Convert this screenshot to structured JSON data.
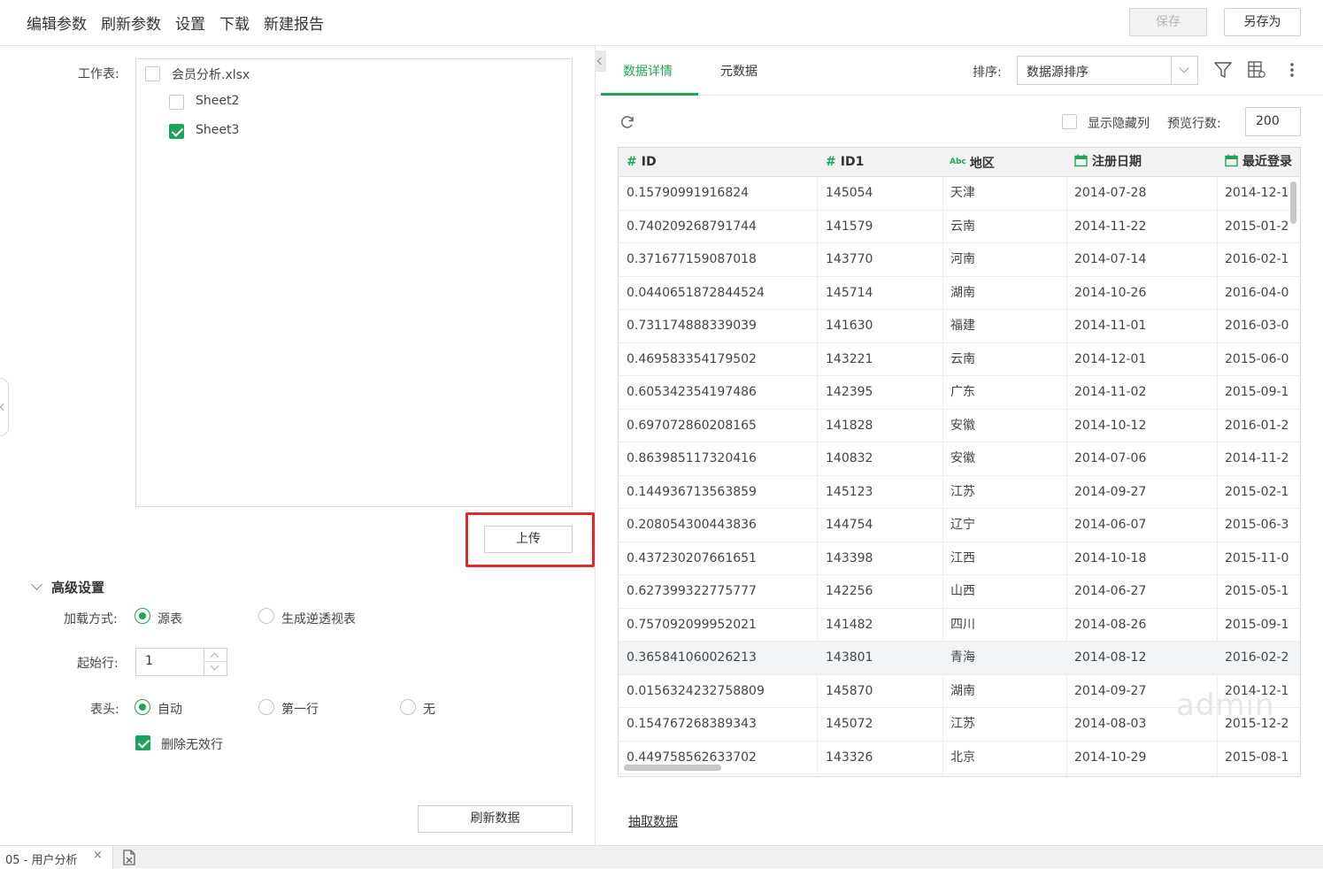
{
  "menu": {
    "items": [
      "编辑参数",
      "刷新参数",
      "设置",
      "下载",
      "新建报告"
    ],
    "save": "保存",
    "save_as": "另存为"
  },
  "left": {
    "worksheet_label": "工作表:",
    "file": {
      "name": "会员分析.xlsx",
      "checked": false
    },
    "sheets": [
      {
        "name": "Sheet2",
        "checked": false
      },
      {
        "name": "Sheet3",
        "checked": true
      }
    ],
    "upload_button": "上传",
    "advanced_title": "高级设置",
    "load_mode_label": "加载方式:",
    "load_mode_options": [
      "源表",
      "生成逆透视表"
    ],
    "start_row_label": "起始行:",
    "start_row_value": "1",
    "header_label": "表头:",
    "header_options": [
      "自动",
      "第一行",
      "无"
    ],
    "delete_invalid_label": "删除无效行",
    "delete_invalid_checked": true,
    "refresh_button": "刷新数据"
  },
  "right": {
    "tabs": [
      "数据详情",
      "元数据"
    ],
    "sort_label": "排序:",
    "sort_value": "数据源排序",
    "show_hidden_label": "显示隐藏列",
    "preview_rows_label": "预览行数:",
    "preview_rows_value": "200",
    "columns": [
      {
        "name": "ID",
        "type_icon": "#"
      },
      {
        "name": "ID1",
        "type_icon": "#"
      },
      {
        "name": "地区",
        "type_icon": "Abc"
      },
      {
        "name": "注册日期",
        "type_icon": "calendar"
      },
      {
        "name": "最近登录",
        "type_icon": "calendar"
      }
    ],
    "rows": [
      [
        "0.15790991916824",
        "145054",
        "天津",
        "2014-07-28",
        "2014-12-1"
      ],
      [
        "0.740209268791744",
        "141579",
        "云南",
        "2014-11-22",
        "2015-01-2"
      ],
      [
        "0.371677159087018",
        "143770",
        "河南",
        "2014-07-14",
        "2016-02-1"
      ],
      [
        "0.0440651872844524",
        "145714",
        "湖南",
        "2014-10-26",
        "2016-04-0"
      ],
      [
        "0.731174888339039",
        "141630",
        "福建",
        "2014-11-01",
        "2016-03-0"
      ],
      [
        "0.469583354179502",
        "143221",
        "云南",
        "2014-12-01",
        "2015-06-0"
      ],
      [
        "0.605342354197486",
        "142395",
        "广东",
        "2014-11-02",
        "2015-09-1"
      ],
      [
        "0.697072860208165",
        "141828",
        "安徽",
        "2014-10-12",
        "2016-01-2"
      ],
      [
        "0.863985117320416",
        "140832",
        "安徽",
        "2014-07-06",
        "2014-11-2"
      ],
      [
        "0.144936713563859",
        "145123",
        "江苏",
        "2014-09-27",
        "2015-02-1"
      ],
      [
        "0.208054300443836",
        "144754",
        "辽宁",
        "2014-06-07",
        "2015-06-3"
      ],
      [
        "0.437230207661651",
        "143398",
        "江西",
        "2014-10-18",
        "2015-11-0"
      ],
      [
        "0.627399322775777",
        "142256",
        "山西",
        "2014-06-27",
        "2015-05-1"
      ],
      [
        "0.757092099952021",
        "141482",
        "四川",
        "2014-08-26",
        "2015-09-1"
      ],
      [
        "0.365841060026213",
        "143801",
        "青海",
        "2014-08-12",
        "2016-02-2"
      ],
      [
        "0.0156324232758809",
        "145870",
        "湖南",
        "2014-09-27",
        "2014-12-1"
      ],
      [
        "0.154767268389343",
        "145072",
        "江苏",
        "2014-08-03",
        "2015-12-2"
      ],
      [
        "0.449758562633702",
        "143326",
        "北京",
        "2014-10-29",
        "2015-08-1"
      ]
    ],
    "highlighted_row": 14,
    "watermark": "admin",
    "extract_link": "抽取数据"
  },
  "bottom": {
    "tab_label": "05 - 用户分析",
    "close_glyph": "×"
  },
  "colors": {
    "accent": "#1fa35b",
    "highlight_border": "#e02b2b"
  }
}
